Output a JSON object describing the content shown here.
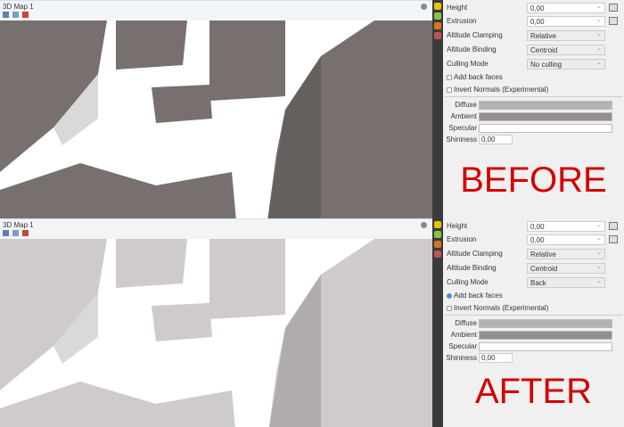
{
  "colors": {
    "accent": "#d40000",
    "building_before": "#77706f",
    "building_after": "#cfcbcb",
    "diffuse": "#b3b3b3",
    "ambient": "#958e8e",
    "specular": "#ffffff"
  },
  "panels": [
    {
      "map_title": "3D Map 1",
      "height_label": "Height",
      "height_value": "0,00",
      "extrusion_label": "Extrusion",
      "extrusion_value": "0,00",
      "clamping_label": "Altitude Clamping",
      "clamping_value": "Relative",
      "binding_label": "Altitude Binding",
      "binding_value": "Centroid",
      "culling_label": "Culling Mode",
      "culling_value": "No culling",
      "back_faces_label": "Add back faces",
      "back_faces_checked": false,
      "invert_label": "Invert Normals (Experimental)",
      "invert_checked": false,
      "diffuse_label": "Diffuse",
      "ambient_label": "Ambient",
      "specular_label": "Specular",
      "shininess_label": "Shininess",
      "shininess_value": "0,00",
      "caption": "BEFORE"
    },
    {
      "map_title": "3D Map 1",
      "height_label": "Height",
      "height_value": "0,00",
      "extrusion_label": "Extrusion",
      "extrusion_value": "0,00",
      "clamping_label": "Altitude Clamping",
      "clamping_value": "Relative",
      "binding_label": "Altitude Binding",
      "binding_value": "Centroid",
      "culling_label": "Culling Mode",
      "culling_value": "Back",
      "back_faces_label": "Add back faces",
      "back_faces_checked": true,
      "invert_label": "Invert Normals (Experimental)",
      "invert_checked": false,
      "diffuse_label": "Diffuse",
      "ambient_label": "Ambient",
      "specular_label": "Specular",
      "shininess_label": "Shininess",
      "shininess_value": "0,00",
      "caption": "AFTER"
    }
  ]
}
